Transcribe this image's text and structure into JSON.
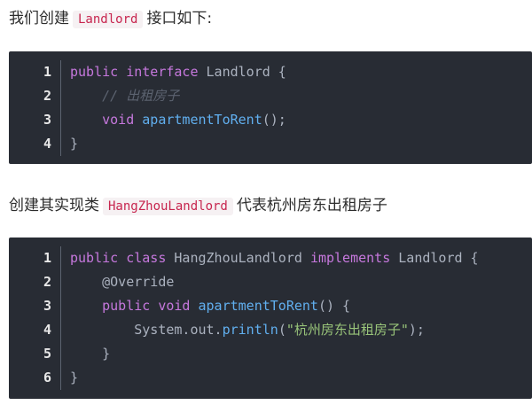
{
  "para1": {
    "before": "我们创建",
    "code": "Landlord",
    "after": "接口如下:"
  },
  "block1": {
    "lines": [
      {
        "num": "1",
        "tokens": [
          [
            "kw",
            "public"
          ],
          [
            "txt",
            " "
          ],
          [
            "kw",
            "interface"
          ],
          [
            "txt",
            " Landlord {"
          ]
        ]
      },
      {
        "num": "2",
        "tokens": [
          [
            "txt",
            "    "
          ],
          [
            "cm",
            "// 出租房子"
          ]
        ]
      },
      {
        "num": "3",
        "tokens": [
          [
            "txt",
            "    "
          ],
          [
            "kw",
            "void"
          ],
          [
            "txt",
            " "
          ],
          [
            "fn",
            "apartmentToRent"
          ],
          [
            "txt",
            "();"
          ]
        ]
      },
      {
        "num": "4",
        "tokens": [
          [
            "txt",
            "}"
          ]
        ]
      }
    ]
  },
  "para2": {
    "before": "创建其实现类",
    "code": "HangZhouLandlord",
    "after": "代表杭州房东出租房子"
  },
  "block2": {
    "lines": [
      {
        "num": "1",
        "tokens": [
          [
            "kw",
            "public"
          ],
          [
            "txt",
            " "
          ],
          [
            "kw",
            "class"
          ],
          [
            "txt",
            " HangZhouLandlord "
          ],
          [
            "kw",
            "implements"
          ],
          [
            "txt",
            " Landlord {"
          ]
        ]
      },
      {
        "num": "2",
        "tokens": [
          [
            "txt",
            "    @Override"
          ]
        ]
      },
      {
        "num": "3",
        "tokens": [
          [
            "txt",
            "    "
          ],
          [
            "kw",
            "public"
          ],
          [
            "txt",
            " "
          ],
          [
            "kw",
            "void"
          ],
          [
            "txt",
            " "
          ],
          [
            "fn",
            "apartmentToRent"
          ],
          [
            "txt",
            "() {"
          ]
        ]
      },
      {
        "num": "4",
        "tokens": [
          [
            "txt",
            "        System.out."
          ],
          [
            "fn",
            "println"
          ],
          [
            "txt",
            "("
          ],
          [
            "str",
            "\"杭州房东出租房子\""
          ],
          [
            "txt",
            ");"
          ]
        ]
      },
      {
        "num": "5",
        "tokens": [
          [
            "txt",
            "    }"
          ]
        ]
      },
      {
        "num": "6",
        "tokens": [
          [
            "txt",
            "}"
          ]
        ]
      }
    ]
  }
}
